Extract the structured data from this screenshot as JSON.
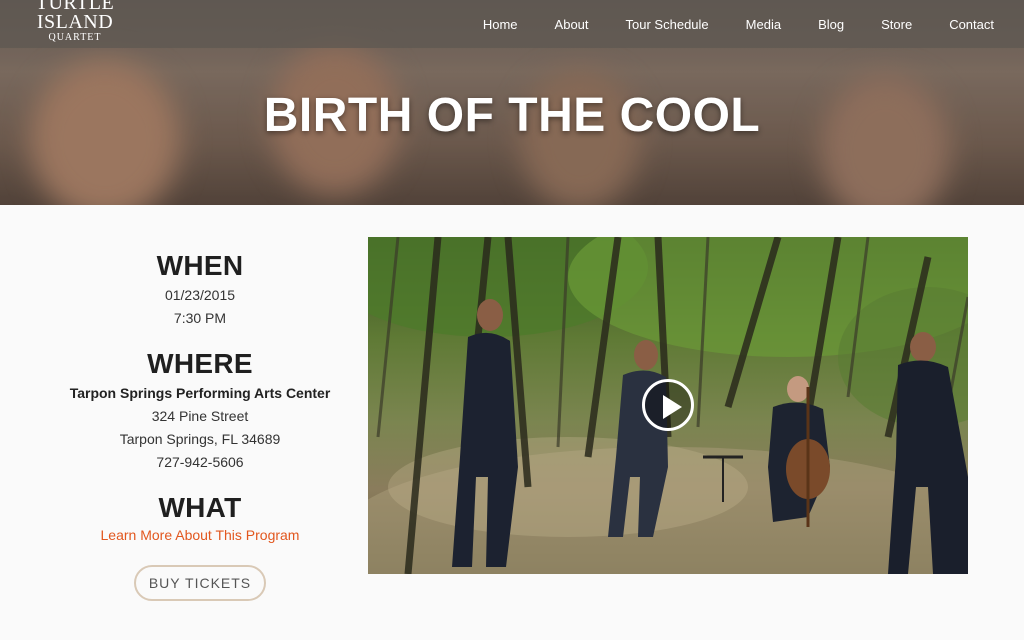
{
  "brand": {
    "logo_line1": "TURTLE",
    "logo_line2": "ISLAND",
    "logo_line3": "QUARTET"
  },
  "nav": [
    {
      "label": "Home"
    },
    {
      "label": "About"
    },
    {
      "label": "Tour Schedule"
    },
    {
      "label": "Media"
    },
    {
      "label": "Blog"
    },
    {
      "label": "Store"
    },
    {
      "label": "Contact"
    }
  ],
  "hero": {
    "title": "BIRTH OF THE COOL"
  },
  "event": {
    "when_heading": "WHEN",
    "date": "01/23/2015",
    "time": "7:30 PM",
    "where_heading": "WHERE",
    "venue": "Tarpon Springs Performing Arts Center",
    "street": "324 Pine Street",
    "city": "Tarpon Springs, FL 34689",
    "phone": "727-942-5606",
    "what_heading": "WHAT",
    "learn_more": "Learn More About This Program",
    "tickets_label": "BUY TICKETS"
  },
  "colors": {
    "accent": "#e2571e",
    "button_border": "#d9c9b6",
    "header_bg": "#5f5852"
  },
  "icons": {
    "play": "play-icon"
  }
}
